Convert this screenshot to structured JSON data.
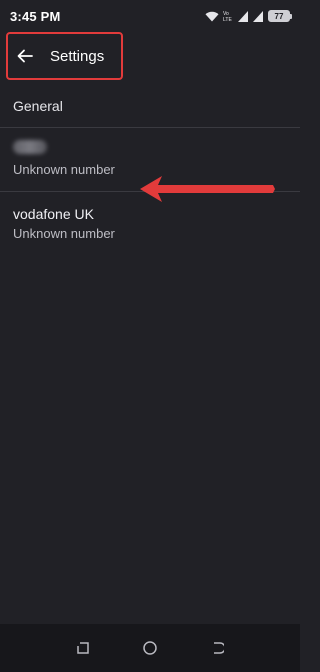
{
  "status_bar": {
    "time": "3:45 PM",
    "battery": "77",
    "icons": [
      "wifi-icon",
      "volte-icon",
      "signal-icon",
      "signal-icon",
      "battery-icon"
    ]
  },
  "header": {
    "title": "Settings",
    "back_icon": "back-arrow-icon",
    "highlight_color": "#e23b3b"
  },
  "list": {
    "general_label": "General",
    "items": [
      {
        "name": "",
        "subtitle": "Unknown number"
      },
      {
        "name": "vodafone UK",
        "subtitle": "Unknown number"
      }
    ]
  },
  "annotation": {
    "type": "red-arrow",
    "color": "#e23b3b"
  },
  "nav_bar": {
    "buttons": [
      "recents-icon",
      "home-icon",
      "back-icon"
    ]
  }
}
